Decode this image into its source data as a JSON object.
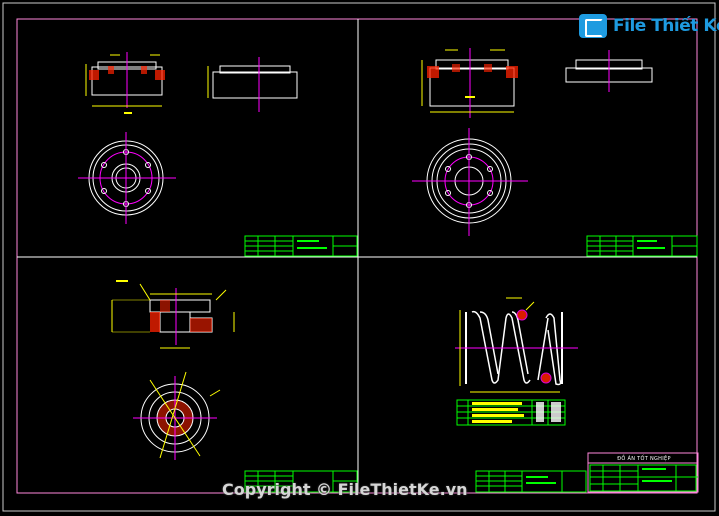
{
  "watermark": {
    "logo_text": "File Thiết Kế.vn",
    "copyright": "Copyright © FileThietKe.vn"
  },
  "drawing": {
    "sheet4_title": "ĐỒ ÁN TỐT NGHIỆP"
  },
  "colors": {
    "border": "#ff88dd",
    "frame": "#ffffff",
    "part": "#ffffff",
    "centerline": "#ff00ff",
    "dimension": "#ffff00",
    "hatch": "#ff2200",
    "titleblock": "#00ff00",
    "logo": "#1e9be0"
  }
}
